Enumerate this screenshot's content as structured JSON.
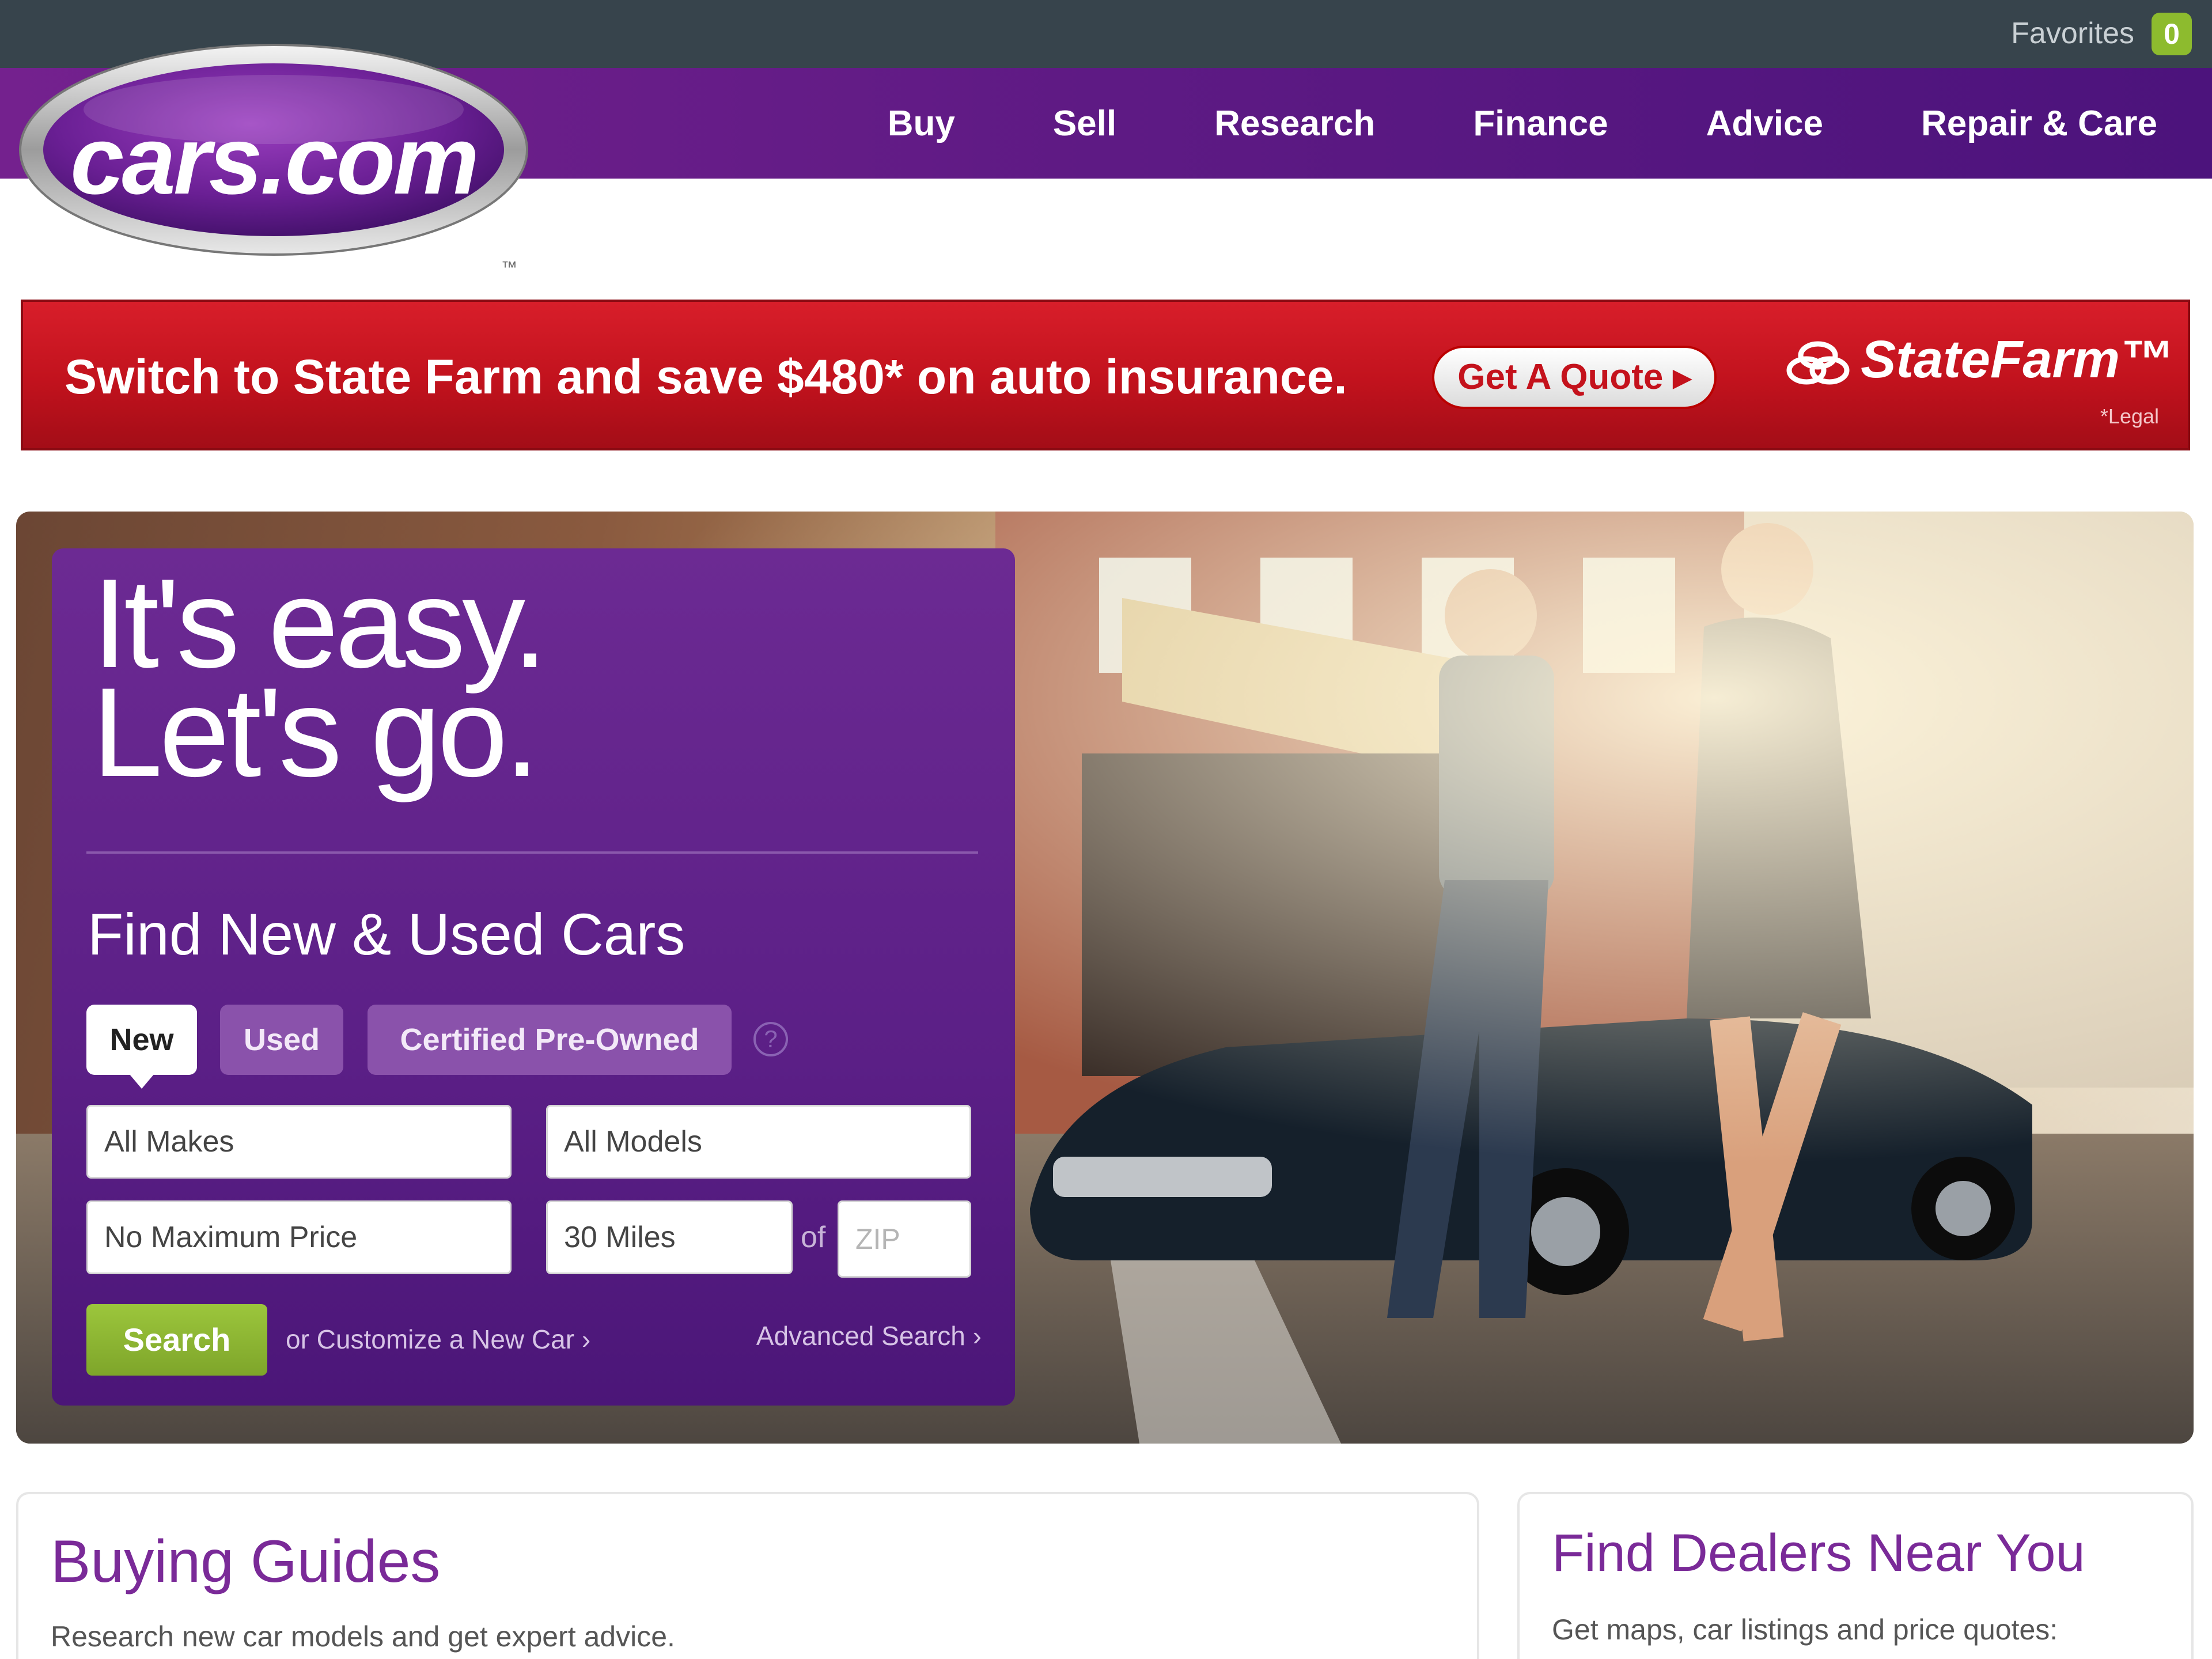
{
  "header": {
    "favorites_label": "Favorites",
    "favorites_count": "0",
    "logo_text": "cars.com",
    "logo_tm": "™",
    "nav": [
      "Buy",
      "Sell",
      "Research",
      "Finance",
      "Advice",
      "Repair & Care"
    ]
  },
  "ad": {
    "headline": "Switch to State Farm and save $480* on auto insurance.",
    "cta": "Get A Quote ▸",
    "brand": "StateFarm™",
    "legal": "*Legal"
  },
  "search": {
    "tagline_line1": "It's easy.",
    "tagline_line2": "Let's go.",
    "title": "Find New & Used Cars",
    "tabs": {
      "new": "New",
      "used": "Used",
      "cpo": "Certified Pre-Owned"
    },
    "help": "?",
    "makes": "All Makes",
    "models": "All Models",
    "price": "No Maximum Price",
    "distance": "30 Miles",
    "of_label": "of",
    "zip_placeholder": "ZIP",
    "search_button": "Search",
    "customize_link": "or Customize a New Car ›",
    "advanced_link": "Advanced Search ›"
  },
  "cards": {
    "guides_title": "Buying Guides",
    "guides_desc": "Research new car models and get expert advice.",
    "dealers_title": "Find Dealers Near You",
    "dealers_desc": "Get maps, car listings and price quotes:"
  },
  "colors": {
    "brand_purple": "#5e1a84",
    "utility_bar": "#37444c",
    "ad_red": "#c1121d",
    "search_green": "#8dbb2e"
  }
}
